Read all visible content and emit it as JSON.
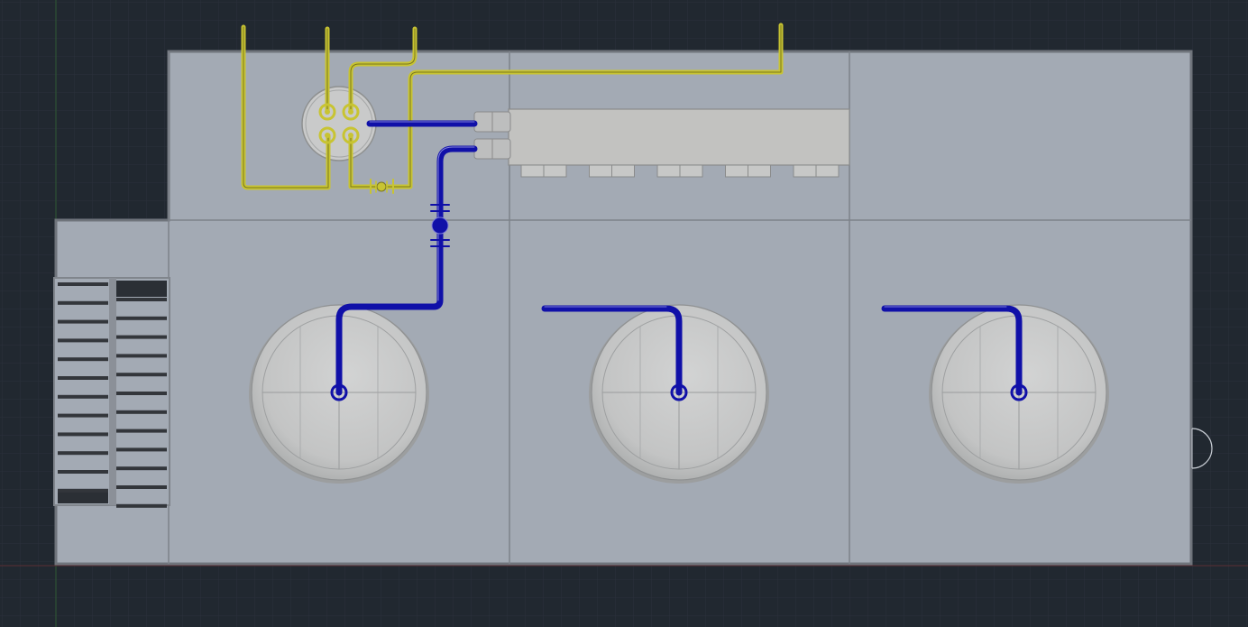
{
  "page": {
    "title": ""
  },
  "colors": {
    "background": "#212830",
    "grid_minor": "#2a313b",
    "grid_major": "#333b46",
    "floor": "#a3aab4",
    "wall": "#6f747b",
    "tank_fill": "#c6c7c7",
    "tank_rim": "#9ea0a1",
    "pipe_blue": "#1010a8",
    "pipe_yellow": "#c8c432",
    "manifold": "#c2c2c0",
    "stair": "#33363b"
  },
  "diagram": {
    "view": "top-plan",
    "rooms": 3,
    "tanks": [
      {
        "id": "tank-1",
        "shape": "spherical"
      },
      {
        "id": "tank-2",
        "shape": "spherical"
      },
      {
        "id": "tank-3",
        "shape": "spherical"
      }
    ],
    "manifold": {
      "outlets": 5,
      "inlets": 2
    },
    "pump_vessel": {
      "ports": 4
    },
    "stair": {
      "flights": 2
    },
    "valves": [
      "blue-line-valve",
      "yellow-line-valve"
    ]
  }
}
